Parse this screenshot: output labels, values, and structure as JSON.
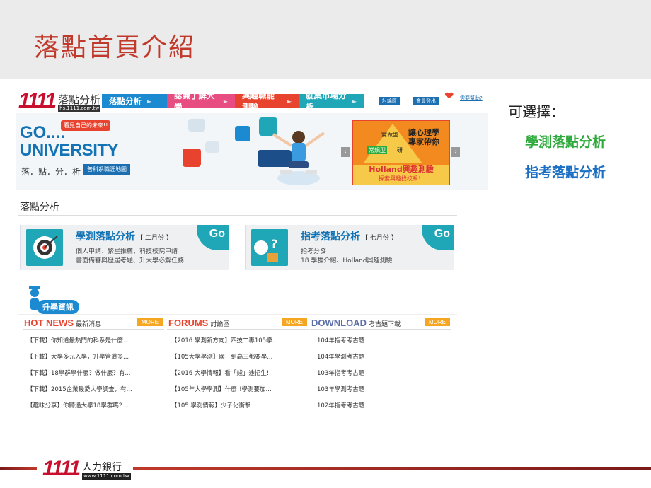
{
  "slide": {
    "title": "落點首頁介紹"
  },
  "site": {
    "logo_num": "1111",
    "logo_cn": "落點分析",
    "logo_url": "hs.1111.com.tw",
    "nav": [
      "落點分析",
      "認識了解大學",
      "興趣職能測驗",
      "就業市場分析"
    ],
    "btn_forum": "討論區",
    "btn_member": "會員登出",
    "help": "需要幫助?"
  },
  "banner": {
    "go": "GO....",
    "tag": "看見自己的未來!!",
    "university": "UNIVERSITY",
    "subtitle": "落．點．分．析",
    "map_tag": "普科系職涯地圖",
    "holland_left": "常規型",
    "holland_top": "實做型",
    "holland_right": "研",
    "holland_text1": "讓心理學",
    "holland_text2": "專家帶你",
    "holland_band1": "Holland興趣測驗",
    "holland_band2": "探索興趣找校系！",
    "arrow_left": "‹",
    "arrow_right": "›"
  },
  "section": {
    "title": "落點分析"
  },
  "cards": [
    {
      "title": "學測落點分析",
      "month": "【 二月份 】",
      "line1": "個人申請、繁星推薦、科技校院申請",
      "line2": "書面備審與歷屆考題、升大學必解任務",
      "go": "Go"
    },
    {
      "title": "指考落點分析",
      "month": "【 七月份 】",
      "line1": "指考分發",
      "line2": "18 學群介紹、Holland興趣測驗",
      "go": "Go"
    }
  ],
  "info": {
    "label": "升學資訊"
  },
  "columns": [
    {
      "big": "HOT NEWS",
      "small": "最新消息",
      "more": "MORE",
      "color": "#e8432e",
      "rows": [
        "【下載】你知道最熱門的科系是什麼...",
        "【下載】大學多元入學，升學管道多...",
        "【下載】18學群學什麼？做什麼？有...",
        "【下載】2015企業最愛大學調查，有...",
        "【趣味分享】你聽過大學18學群嗎？..."
      ]
    },
    {
      "big": "FORUMS",
      "small": "討論區",
      "more": "MORE",
      "color": "#e8432e",
      "rows": [
        "【2016 學測新方向】四技二專105學...",
        "【105大學學測】國一到高三都要學...",
        "【2016 大學情報】看「錢」途招生!",
        "【105年大學學測】什麼!!學測要加...",
        "【105 學測情報】少子化衝擊"
      ]
    },
    {
      "big": "DOWNLOAD",
      "small": "考古題下載",
      "more": "MORE",
      "color": "#5b6ea8",
      "rows": [
        "104年指考考古題",
        "104年學測考古題",
        "103年指考考古題",
        "103年學測考古題",
        "102年指考考古題"
      ]
    }
  ],
  "side": {
    "label": "可選擇：",
    "options": [
      {
        "text": "學測落點分析",
        "color": "#2eaa3c"
      },
      {
        "text": "指考落點分析",
        "color": "#1a6fc4"
      }
    ]
  },
  "footer": {
    "num": "1111",
    "cn": "人力銀行",
    "url": "www.1111.com.tw"
  }
}
